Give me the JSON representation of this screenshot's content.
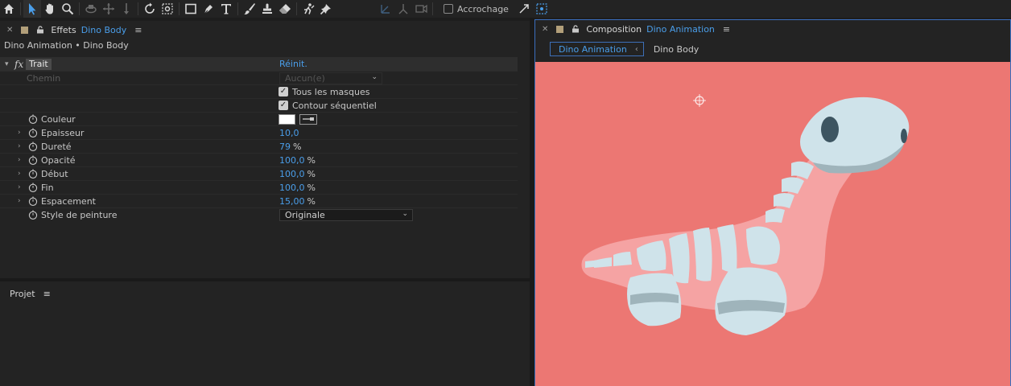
{
  "toolbar": {
    "snapping_label": "Accrochage",
    "tools": [
      "home-icon",
      "selection-tool-icon",
      "hand-tool-icon",
      "zoom-tool-icon",
      "orbit-camera-icon",
      "pan-camera-icon",
      "dolly-camera-icon",
      "rotation-tool-icon",
      "pan-behind-tool-icon",
      "rectangle-tool-icon",
      "pen-tool-icon",
      "type-tool-icon",
      "brush-tool-icon",
      "clone-stamp-icon",
      "eraser-tool-icon",
      "roto-brush-icon",
      "puppet-pin-icon"
    ]
  },
  "effects_panel": {
    "title": "Effets",
    "layer": "Dino Body",
    "breadcrumb": "Dino Animation • Dino Body",
    "effect_name": "Trait",
    "reset_label": "Réinit.",
    "path": {
      "label": "Chemin",
      "value": "Aucun(e)"
    },
    "all_masks": "Tous les masques",
    "sequential": "Contour séquentiel",
    "color": {
      "label": "Couleur",
      "value": "#ffffff"
    },
    "brush_size": {
      "label": "Epaisseur",
      "value": "10,0"
    },
    "hardness": {
      "label": "Dureté",
      "value": "79",
      "unit": "%"
    },
    "opacity": {
      "label": "Opacité",
      "value": "100,0",
      "unit": "%"
    },
    "start": {
      "label": "Début",
      "value": "100,0",
      "unit": "%"
    },
    "end": {
      "label": "Fin",
      "value": "100,0",
      "unit": "%"
    },
    "spacing": {
      "label": "Espacement",
      "value": "15,00",
      "unit": "%"
    },
    "paint_style": {
      "label": "Style de peinture",
      "value": "Originale"
    }
  },
  "project_panel": {
    "title": "Projet"
  },
  "composition_panel": {
    "title": "Composition",
    "comp_name": "Dino Animation",
    "tab_active": "Dino Animation",
    "tab_layer": "Dino Body",
    "background_color": "#ec7773"
  }
}
